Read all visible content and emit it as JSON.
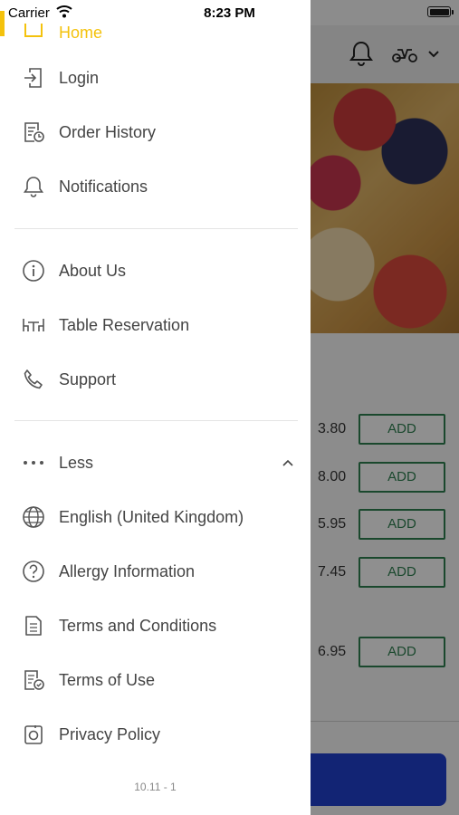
{
  "status_bar": {
    "carrier": "Carrier",
    "time": "8:23 PM"
  },
  "drawer": {
    "home_label": "Home",
    "primary_items": [
      {
        "label": "Login",
        "icon": "login-icon"
      },
      {
        "label": "Order History",
        "icon": "order-history-icon"
      },
      {
        "label": "Notifications",
        "icon": "bell-icon"
      }
    ],
    "secondary_items": [
      {
        "label": "About Us",
        "icon": "info-icon"
      },
      {
        "label": "Table Reservation",
        "icon": "table-icon"
      },
      {
        "label": "Support",
        "icon": "phone-icon"
      }
    ],
    "less_toggle": {
      "label": "Less",
      "icon": "more-dots-icon"
    },
    "more_items": [
      {
        "label": "English (United Kingdom)",
        "icon": "globe-icon"
      },
      {
        "label": "Allergy Information",
        "icon": "question-icon"
      },
      {
        "label": "Terms and Conditions",
        "icon": "document-icon"
      },
      {
        "label": "Terms of Use",
        "icon": "document-check-icon"
      },
      {
        "label": "Privacy Policy",
        "icon": "privacy-icon"
      }
    ],
    "version": "10.11 - 1"
  },
  "background": {
    "prices": [
      "3.80",
      "8.00",
      "5.95",
      "7.45",
      "6.95"
    ],
    "add_label": "ADD"
  },
  "colors": {
    "accent": "#f4c20d",
    "add_green": "#2e7d4f",
    "bottom_button": "#1f3ec9"
  }
}
